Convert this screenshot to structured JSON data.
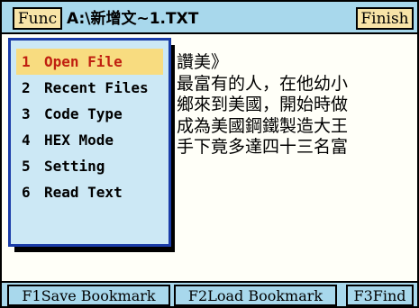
{
  "titlebar": {
    "func_label": "Func",
    "file_path": "A:\\新增文~1.TXT",
    "finish_label": "Finish"
  },
  "content": {
    "lines": [
      "讚美》",
      "最富有的人，在他幼小",
      "鄉來到美國，開始時做",
      "成為美國鋼鐵製造大王",
      "手下竟多達四十三名富"
    ]
  },
  "menu": {
    "items": [
      {
        "num": "1",
        "label": "Open File"
      },
      {
        "num": "2",
        "label": "Recent Files"
      },
      {
        "num": "3",
        "label": "Code Type"
      },
      {
        "num": "4",
        "label": "HEX Mode"
      },
      {
        "num": "5",
        "label": "Setting"
      },
      {
        "num": "6",
        "label": "Read Text"
      }
    ]
  },
  "fbar": {
    "f1": "F1Save Bookmark",
    "f2": "F2Load Bookmark",
    "f3": "F3Find"
  }
}
